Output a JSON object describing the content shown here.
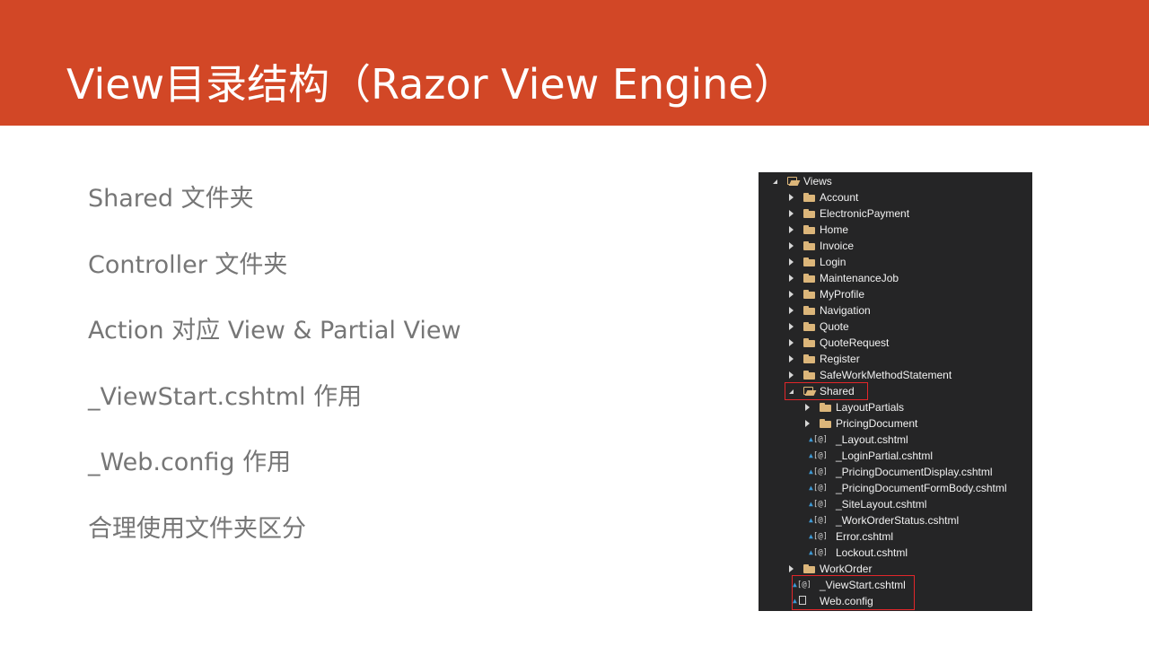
{
  "slide": {
    "title": "View目录结构（Razor View Engine）",
    "bullets": [
      "Shared 文件夹",
      "Controller 文件夹",
      "Action 对应 View & Partial View",
      "_ViewStart.cshtml 作用",
      "_Web.config 作用",
      "合理使用文件夹区分"
    ]
  },
  "solution_explorer": {
    "root": "Views",
    "folders_before_shared": [
      "Account",
      "ElectronicPayment",
      "Home",
      "Invoice",
      "Login",
      "MaintenanceJob",
      "MyProfile",
      "Navigation",
      "Quote",
      "QuoteRequest",
      "Register",
      "SafeWorkMethodStatement"
    ],
    "shared": {
      "label": "Shared",
      "subfolders": [
        "LayoutPartials",
        "PricingDocument"
      ],
      "files": [
        "_Layout.cshtml",
        "_LoginPartial.cshtml",
        "_PricingDocumentDisplay.cshtml",
        "_PricingDocumentFormBody.cshtml",
        "_SiteLayout.cshtml",
        "_WorkOrderStatus.cshtml",
        "Error.cshtml",
        "Lockout.cshtml"
      ]
    },
    "folders_after_shared": [
      "WorkOrder"
    ],
    "root_files": [
      "_ViewStart.cshtml",
      "Web.config"
    ],
    "icons": {
      "folder": "folder-icon",
      "open_folder": "open-folder-icon",
      "razor_file": "razor-file-icon",
      "config_file": "config-file-icon",
      "lock": "lock-icon"
    },
    "colors": {
      "panel_background": "#252526",
      "folder": "#dcb67a",
      "highlight_border": "#e2262a",
      "lock": "#3e9ad6"
    }
  },
  "colors": {
    "title_bar": "#d24726",
    "title_text": "#ffffff",
    "bullet_text": "#767676"
  }
}
